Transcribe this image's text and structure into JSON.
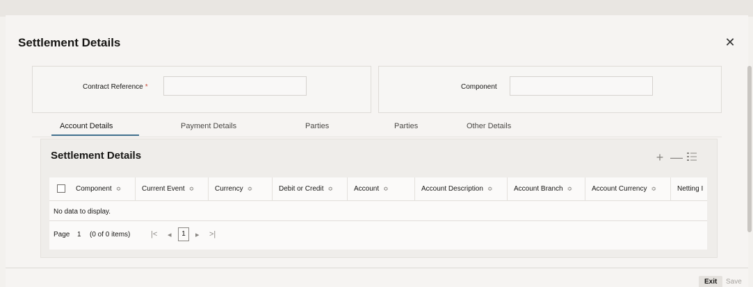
{
  "dialog": {
    "title": "Settlement Details",
    "close_icon": "close-icon"
  },
  "form": {
    "contract_reference_label": "Contract Reference",
    "required_mark": "*",
    "contract_reference_value": "",
    "component_label": "Component",
    "component_value": ""
  },
  "tabs": [
    {
      "label": "Account Details",
      "active": true
    },
    {
      "label": "Payment Details",
      "active": false
    },
    {
      "label": "Parties",
      "active": false
    },
    {
      "label": "Parties",
      "active": false
    },
    {
      "label": "Other Details",
      "active": false
    }
  ],
  "section": {
    "title": "Settlement Details"
  },
  "toolbar": {
    "add_icon": "plus-icon",
    "remove_icon": "minus-icon",
    "columns_icon": "list-icon"
  },
  "grid": {
    "columns": [
      "Component",
      "Current Event",
      "Currency",
      "Debit or Credit",
      "Account",
      "Account Description",
      "Account Branch",
      "Account Currency",
      "Netting I"
    ],
    "empty_text": "No data to display."
  },
  "pagination": {
    "page_label": "Page",
    "page_value": "1",
    "items_text": "(0 of 0 items)",
    "first_glyph": "|<",
    "prev_glyph": "◂",
    "current_page": "1",
    "next_glyph": "▸",
    "last_glyph": ">|"
  },
  "footer": {
    "exit_label": "Exit",
    "save_label": "Save"
  },
  "colors": {
    "accent": "#3f6e8c",
    "required": "#c74634"
  }
}
